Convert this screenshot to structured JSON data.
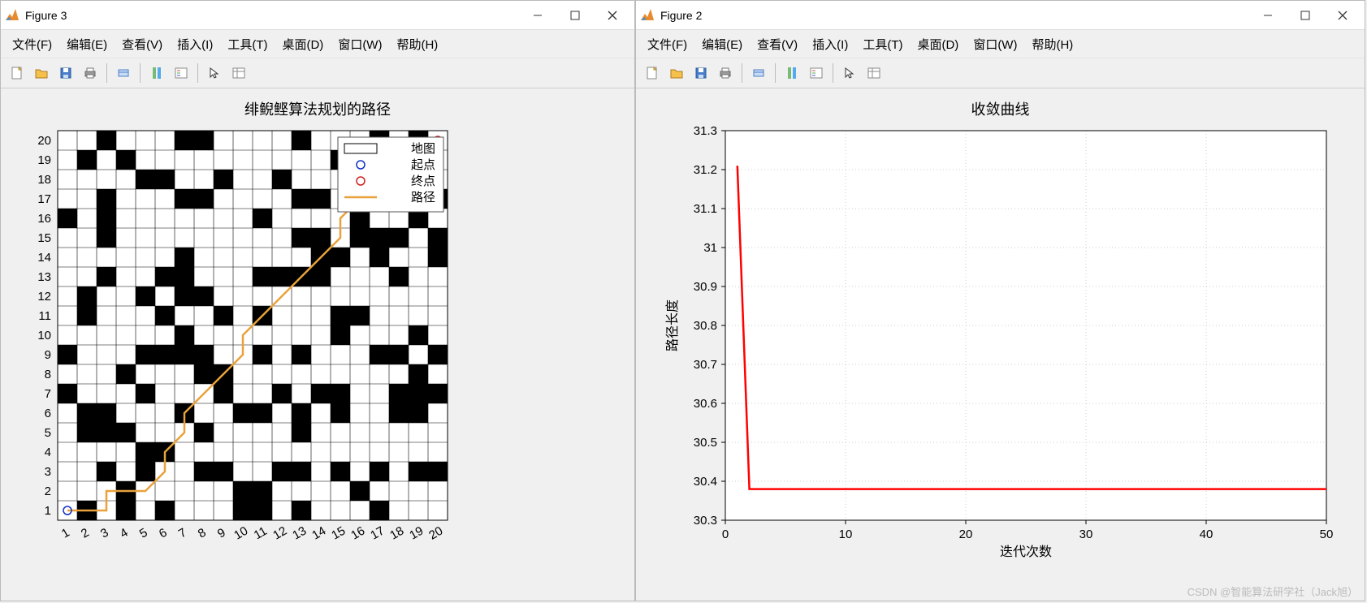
{
  "windows": [
    {
      "title": "Figure 3",
      "menus": [
        "文件(F)",
        "编辑(E)",
        "查看(V)",
        "插入(I)",
        "工具(T)",
        "桌面(D)",
        "窗口(W)",
        "帮助(H)"
      ],
      "chart_title": "绯鲵鲣算法规划的路径"
    },
    {
      "title": "Figure 2",
      "menus": [
        "文件(F)",
        "编辑(E)",
        "查看(V)",
        "插入(I)",
        "工具(T)",
        "桌面(D)",
        "窗口(W)",
        "帮助(H)"
      ],
      "chart_title": "收敛曲线"
    }
  ],
  "legend": {
    "map": "地图",
    "start": "起点",
    "end": "终点",
    "path": "路径"
  },
  "grid_ticks": {
    "x": [
      "1",
      "2",
      "3",
      "4",
      "5",
      "6",
      "7",
      "8",
      "9",
      "10",
      "11",
      "12",
      "13",
      "14",
      "15",
      "16",
      "17",
      "18",
      "19",
      "20"
    ],
    "y": [
      "1",
      "2",
      "3",
      "4",
      "5",
      "6",
      "7",
      "8",
      "9",
      "10",
      "11",
      "12",
      "13",
      "14",
      "15",
      "16",
      "17",
      "18",
      "19",
      "20"
    ]
  },
  "convergence_yticks": [
    "30.3",
    "30.4",
    "30.5",
    "30.6",
    "30.7",
    "30.8",
    "30.9",
    "31",
    "31.1",
    "31.2",
    "31.3"
  ],
  "convergence_xticks": [
    "0",
    "10",
    "20",
    "30",
    "40",
    "50"
  ],
  "xlabel": "迭代次数",
  "ylabel": "路径长度",
  "watermark": "CSDN @智能算法研学社（Jack旭）",
  "chart_data": [
    {
      "type": "heatmap",
      "title": "绯鲵鲣算法规划的路径",
      "grid_size": 20,
      "obstacles": [
        [
          2,
          1
        ],
        [
          4,
          1
        ],
        [
          6,
          1
        ],
        [
          10,
          1
        ],
        [
          11,
          1
        ],
        [
          13,
          1
        ],
        [
          17,
          1
        ],
        [
          4,
          2
        ],
        [
          10,
          2
        ],
        [
          11,
          2
        ],
        [
          16,
          2
        ],
        [
          3,
          3
        ],
        [
          5,
          3
        ],
        [
          8,
          3
        ],
        [
          9,
          3
        ],
        [
          12,
          3
        ],
        [
          13,
          3
        ],
        [
          15,
          3
        ],
        [
          17,
          3
        ],
        [
          19,
          3
        ],
        [
          20,
          3
        ],
        [
          5,
          4
        ],
        [
          6,
          4
        ],
        [
          2,
          5
        ],
        [
          3,
          5
        ],
        [
          4,
          5
        ],
        [
          8,
          5
        ],
        [
          13,
          5
        ],
        [
          2,
          6
        ],
        [
          3,
          6
        ],
        [
          7,
          6
        ],
        [
          10,
          6
        ],
        [
          11,
          6
        ],
        [
          13,
          6
        ],
        [
          15,
          6
        ],
        [
          18,
          6
        ],
        [
          19,
          6
        ],
        [
          1,
          7
        ],
        [
          5,
          7
        ],
        [
          9,
          7
        ],
        [
          12,
          7
        ],
        [
          14,
          7
        ],
        [
          15,
          7
        ],
        [
          18,
          7
        ],
        [
          19,
          7
        ],
        [
          20,
          7
        ],
        [
          4,
          8
        ],
        [
          8,
          8
        ],
        [
          9,
          8
        ],
        [
          19,
          8
        ],
        [
          1,
          9
        ],
        [
          5,
          9
        ],
        [
          6,
          9
        ],
        [
          7,
          9
        ],
        [
          8,
          9
        ],
        [
          11,
          9
        ],
        [
          13,
          9
        ],
        [
          17,
          9
        ],
        [
          18,
          9
        ],
        [
          20,
          9
        ],
        [
          7,
          10
        ],
        [
          15,
          10
        ],
        [
          19,
          10
        ],
        [
          2,
          11
        ],
        [
          6,
          11
        ],
        [
          9,
          11
        ],
        [
          11,
          11
        ],
        [
          15,
          11
        ],
        [
          16,
          11
        ],
        [
          2,
          12
        ],
        [
          5,
          12
        ],
        [
          7,
          12
        ],
        [
          8,
          12
        ],
        [
          3,
          13
        ],
        [
          6,
          13
        ],
        [
          7,
          13
        ],
        [
          11,
          13
        ],
        [
          12,
          13
        ],
        [
          13,
          13
        ],
        [
          14,
          13
        ],
        [
          18,
          13
        ],
        [
          7,
          14
        ],
        [
          14,
          14
        ],
        [
          15,
          14
        ],
        [
          17,
          14
        ],
        [
          20,
          14
        ],
        [
          3,
          15
        ],
        [
          13,
          15
        ],
        [
          14,
          15
        ],
        [
          16,
          15
        ],
        [
          17,
          15
        ],
        [
          18,
          15
        ],
        [
          20,
          15
        ],
        [
          1,
          16
        ],
        [
          3,
          16
        ],
        [
          11,
          16
        ],
        [
          16,
          16
        ],
        [
          19,
          16
        ],
        [
          3,
          17
        ],
        [
          7,
          17
        ],
        [
          8,
          17
        ],
        [
          13,
          17
        ],
        [
          14,
          17
        ],
        [
          20,
          17
        ],
        [
          5,
          18
        ],
        [
          6,
          18
        ],
        [
          9,
          18
        ],
        [
          12,
          18
        ],
        [
          18,
          18
        ],
        [
          2,
          19
        ],
        [
          4,
          19
        ],
        [
          15,
          19
        ],
        [
          16,
          19
        ],
        [
          17,
          19
        ],
        [
          3,
          20
        ],
        [
          7,
          20
        ],
        [
          8,
          20
        ],
        [
          13,
          20
        ],
        [
          17,
          20
        ],
        [
          19,
          20
        ]
      ],
      "start": [
        1,
        1
      ],
      "end": [
        20,
        20
      ],
      "path": [
        [
          1,
          1
        ],
        [
          2,
          1
        ],
        [
          3,
          1
        ],
        [
          3,
          2
        ],
        [
          4,
          2
        ],
        [
          5,
          2
        ],
        [
          5.5,
          2.5
        ],
        [
          6,
          3
        ],
        [
          6,
          4
        ],
        [
          6.5,
          4.5
        ],
        [
          7,
          5
        ],
        [
          7,
          6
        ],
        [
          8,
          7
        ],
        [
          8.5,
          7.5
        ],
        [
          9,
          8
        ],
        [
          9.5,
          8.5
        ],
        [
          10,
          9
        ],
        [
          10,
          10
        ],
        [
          10.5,
          10.5
        ],
        [
          11,
          11
        ],
        [
          11.5,
          11.5
        ],
        [
          12,
          12
        ],
        [
          12.5,
          12.5
        ],
        [
          13,
          13
        ],
        [
          13.5,
          13.5
        ],
        [
          14,
          14
        ],
        [
          14.5,
          14.5
        ],
        [
          15,
          15
        ],
        [
          15,
          16
        ],
        [
          15.5,
          16.5
        ],
        [
          16,
          17
        ],
        [
          16.5,
          17.5
        ],
        [
          17,
          18
        ],
        [
          17.5,
          18.5
        ],
        [
          18,
          19
        ],
        [
          19,
          20
        ],
        [
          20,
          20
        ]
      ],
      "legend_entries": [
        "地图",
        "起点",
        "终点",
        "路径"
      ]
    },
    {
      "type": "line",
      "title": "收敛曲线",
      "xlabel": "迭代次数",
      "ylabel": "路径长度",
      "xlim": [
        0,
        50
      ],
      "ylim": [
        30.3,
        31.3
      ],
      "series": [
        {
          "name": "路径长度",
          "color": "#ff0000",
          "x": [
            1,
            2,
            3,
            5,
            10,
            15,
            20,
            25,
            30,
            35,
            40,
            45,
            50
          ],
          "y": [
            31.21,
            30.38,
            30.38,
            30.38,
            30.38,
            30.38,
            30.38,
            30.38,
            30.38,
            30.38,
            30.38,
            30.38,
            30.38
          ]
        }
      ]
    }
  ]
}
